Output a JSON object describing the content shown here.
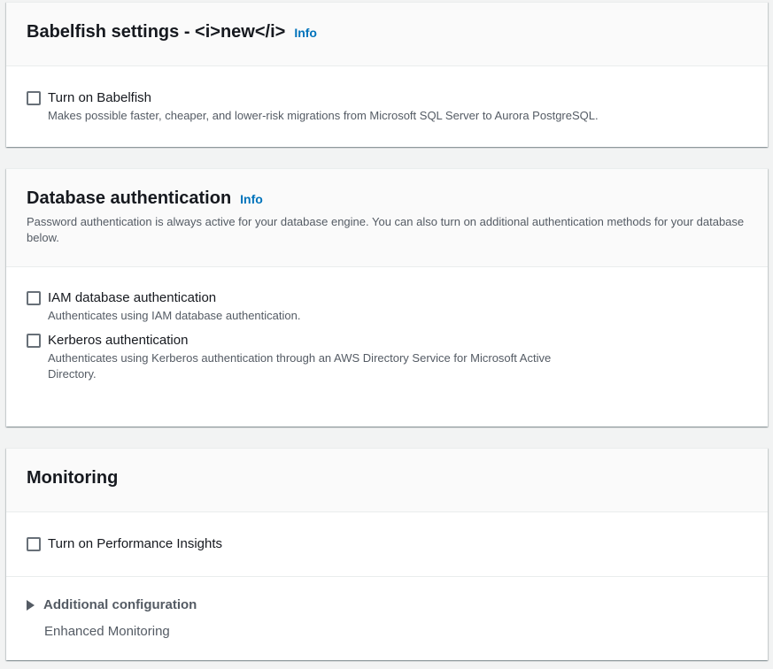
{
  "babelfish": {
    "title": "Babelfish settings - <i>new</i>",
    "info": "Info",
    "option_label": "Turn on Babelfish",
    "option_desc": "Makes possible faster, cheaper, and lower-risk migrations from Microsoft SQL Server to Aurora PostgreSQL."
  },
  "db_auth": {
    "title": "Database authentication",
    "info": "Info",
    "description": "Password authentication is always active for your database engine. You can also turn on additional authentication methods for your database below.",
    "options": [
      {
        "label": "IAM database authentication",
        "desc": "Authenticates using IAM database authentication."
      },
      {
        "label": "Kerberos authentication",
        "desc": "Authenticates using Kerberos authentication through an AWS Directory Service for Microsoft Active Directory."
      }
    ]
  },
  "monitoring": {
    "title": "Monitoring",
    "option_label": "Turn on Performance Insights",
    "additional_config": "Additional configuration",
    "enhanced_monitoring": "Enhanced Monitoring"
  },
  "colors": {
    "link": "#0073bb",
    "text": "#16191f",
    "secondary_text": "#545b64",
    "background": "#f2f3f3"
  }
}
